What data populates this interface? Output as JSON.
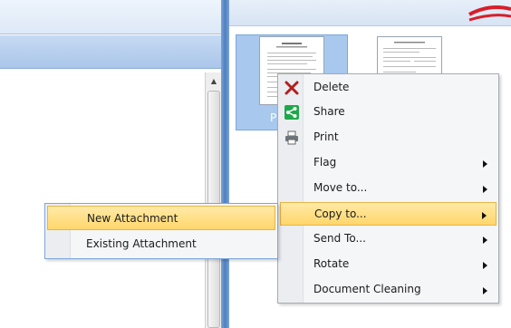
{
  "colors": {
    "splitter": "#4f7fc0",
    "highlight": "#ffd66b",
    "delete_icon": "#b21f1f",
    "share_icon": "#1fa84a",
    "accent_red": "#d81e2a"
  },
  "thumbnails": {
    "selected_caption": "P"
  },
  "context_menu": {
    "items": [
      {
        "label": "Delete",
        "icon": "delete-x-icon"
      },
      {
        "label": "Share",
        "icon": "share-icon"
      },
      {
        "label": "Print",
        "icon": "printer-icon"
      },
      {
        "label": "Flag",
        "has_submenu": true
      },
      {
        "label": "Move to...",
        "has_submenu": true
      },
      {
        "label": "Copy to...",
        "has_submenu": true,
        "highlighted": true
      },
      {
        "label": "Send To...",
        "has_submenu": true
      },
      {
        "label": "Rotate",
        "has_submenu": true
      },
      {
        "label": "Document Cleaning",
        "has_submenu": true
      }
    ]
  },
  "copy_submenu": {
    "items": [
      {
        "label": "New Attachment",
        "highlighted": true
      },
      {
        "label": "Existing Attachment"
      }
    ]
  }
}
